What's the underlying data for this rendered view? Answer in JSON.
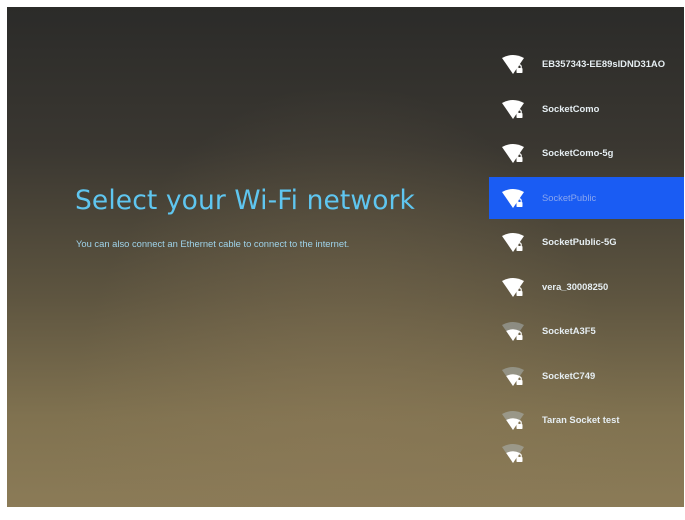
{
  "setup": {
    "title": "Select your Wi-Fi network",
    "subtitle": "You can also connect an Ethernet cable to connect to the internet."
  },
  "networks": [
    {
      "ssid": "EB357343-EE89slDND31AO",
      "signal_icon": "wifi-lock-icon",
      "selected": false
    },
    {
      "ssid": "SocketComo",
      "signal_icon": "wifi-lock-icon",
      "selected": false
    },
    {
      "ssid": "SocketComo-5g",
      "signal_icon": "wifi-lock-icon",
      "selected": false
    },
    {
      "ssid": "SocketPublic",
      "signal_icon": "wifi-lock-icon",
      "selected": true
    },
    {
      "ssid": "SocketPublic-5G",
      "signal_icon": "wifi-lock-icon",
      "selected": false
    },
    {
      "ssid": "vera_30008250",
      "signal_icon": "wifi-lock-icon",
      "selected": false
    },
    {
      "ssid": "SocketA3F5",
      "signal_icon": "wifi-weak-lock-icon",
      "selected": false
    },
    {
      "ssid": "SocketC749",
      "signal_icon": "wifi-weak-lock-icon",
      "selected": false
    },
    {
      "ssid": "Taran Socket test",
      "signal_icon": "wifi-weak-lock-icon",
      "selected": false
    }
  ],
  "colors": {
    "title": "#5fc6f0",
    "selection": "#1a5cf3",
    "list_text": "#e6eef2"
  }
}
